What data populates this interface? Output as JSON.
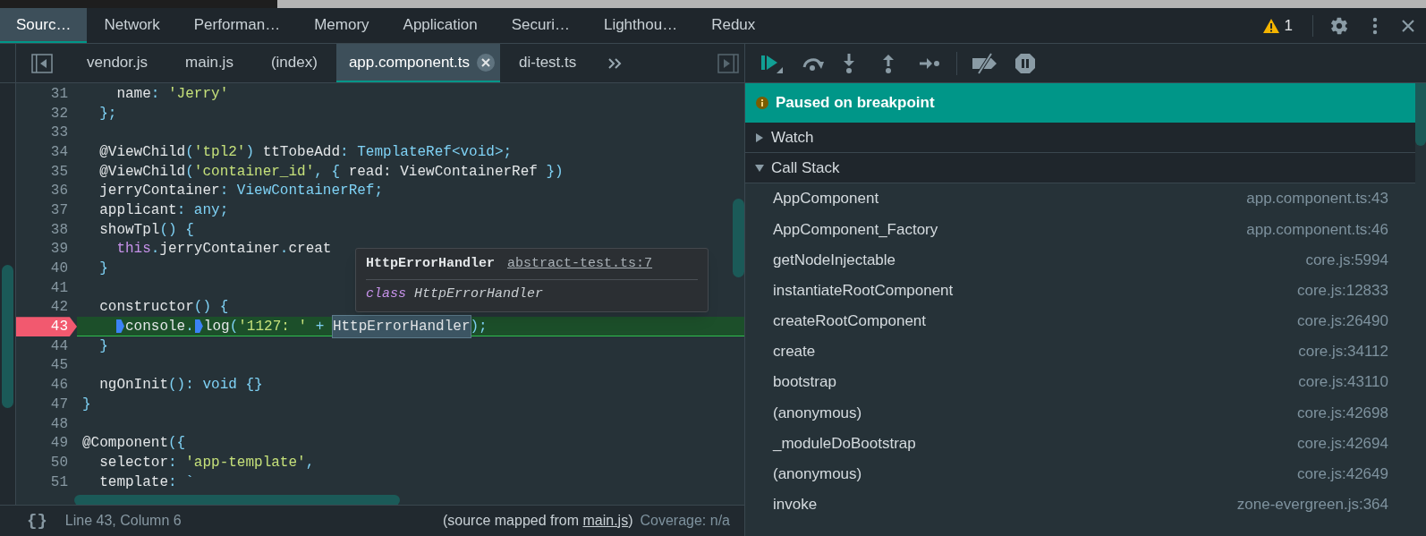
{
  "main_tabs": [
    {
      "label": "Sourc…",
      "selected": true
    },
    {
      "label": "Network",
      "selected": false
    },
    {
      "label": "Performan…",
      "selected": false
    },
    {
      "label": "Memory",
      "selected": false
    },
    {
      "label": "Application",
      "selected": false
    },
    {
      "label": "Securi…",
      "selected": false
    },
    {
      "label": "Lighthou…",
      "selected": false
    },
    {
      "label": "Redux",
      "selected": false
    }
  ],
  "warning_count": "1",
  "file_tabs": [
    {
      "label": "vendor.js",
      "selected": false
    },
    {
      "label": "main.js",
      "selected": false
    },
    {
      "label": "(index)",
      "selected": false
    },
    {
      "label": "app.component.ts",
      "selected": true
    },
    {
      "label": "di-test.ts",
      "selected": false
    }
  ],
  "code_lines": [
    {
      "number": "31",
      "paused": false,
      "tokens": [
        {
          "text": "    name",
          "kind": "plain"
        },
        {
          "text": ": ",
          "kind": "punct"
        },
        {
          "text": "'Jerry'",
          "kind": "string"
        }
      ]
    },
    {
      "number": "32",
      "paused": false,
      "tokens": [
        {
          "text": "  };",
          "kind": "punct"
        }
      ]
    },
    {
      "number": "33",
      "paused": false
    },
    {
      "number": "34",
      "paused": false,
      "tokens": [
        {
          "text": "  @ViewChild",
          "kind": "plain"
        },
        {
          "text": "(",
          "kind": "punct"
        },
        {
          "text": "'tpl2'",
          "kind": "string"
        },
        {
          "text": ")",
          "kind": "punct"
        },
        {
          "text": " ttTobeAdd",
          "kind": "plain"
        },
        {
          "text": ": TemplateRef<void>;",
          "kind": "punct"
        }
      ]
    },
    {
      "number": "35",
      "paused": false,
      "tokens": [
        {
          "text": "  @ViewChild",
          "kind": "plain"
        },
        {
          "text": "(",
          "kind": "punct"
        },
        {
          "text": "'container_id'",
          "kind": "string"
        },
        {
          "text": ", { ",
          "kind": "punct"
        },
        {
          "text": "read: ViewContainerRef",
          "kind": "plain"
        },
        {
          "text": " })",
          "kind": "punct"
        }
      ]
    },
    {
      "number": "36",
      "paused": false,
      "tokens": [
        {
          "text": "  jerryContainer",
          "kind": "plain"
        },
        {
          "text": ": ViewContainerRef;",
          "kind": "punct"
        }
      ]
    },
    {
      "number": "37",
      "paused": false,
      "tokens": [
        {
          "text": "  applicant",
          "kind": "plain"
        },
        {
          "text": ": any;",
          "kind": "punct"
        }
      ]
    },
    {
      "number": "38",
      "paused": false,
      "tokens": [
        {
          "text": "  showTpl",
          "kind": "plain"
        },
        {
          "text": "() {",
          "kind": "punct"
        }
      ]
    },
    {
      "number": "39",
      "paused": false,
      "tokens": [
        {
          "text": "    this",
          "kind": "keyword"
        },
        {
          "text": ".",
          "kind": "punct"
        },
        {
          "text": "jerryContainer",
          "kind": "plain"
        },
        {
          "text": ".",
          "kind": "punct"
        },
        {
          "text": "creat",
          "kind": "plain"
        }
      ]
    },
    {
      "number": "40",
      "paused": false,
      "tokens": [
        {
          "text": "  }",
          "kind": "punct"
        }
      ]
    },
    {
      "number": "41",
      "paused": false
    },
    {
      "number": "42",
      "paused": false,
      "tokens": [
        {
          "text": "  constructor",
          "kind": "plain"
        },
        {
          "text": "() {",
          "kind": "punct"
        }
      ]
    },
    {
      "number": "43",
      "paused": true,
      "tokens": [
        {
          "kind": "breakpoint"
        },
        {
          "text": "console",
          "kind": "plain"
        },
        {
          "text": ".",
          "kind": "punct"
        },
        {
          "kind": "breakpoint"
        },
        {
          "text": "log",
          "kind": "plain"
        },
        {
          "text": "(",
          "kind": "punct"
        },
        {
          "text": "'1127: '",
          "kind": "string"
        },
        {
          "text": " + ",
          "kind": "punct"
        },
        {
          "text": "HttpErrorHandler",
          "kind": "hover"
        },
        {
          "text": ");",
          "kind": "punct"
        }
      ]
    },
    {
      "number": "44",
      "paused": false,
      "tokens": [
        {
          "text": "  }",
          "kind": "punct"
        }
      ]
    },
    {
      "number": "45",
      "paused": false
    },
    {
      "number": "46",
      "paused": false,
      "tokens": [
        {
          "text": "  ngOnInit",
          "kind": "plain"
        },
        {
          "text": "(): void {}",
          "kind": "punct"
        }
      ]
    },
    {
      "number": "47",
      "paused": false,
      "tokens": [
        {
          "text": "}",
          "kind": "punct"
        }
      ]
    },
    {
      "number": "48",
      "paused": false
    },
    {
      "number": "49",
      "paused": false,
      "tokens": [
        {
          "text": "@Component",
          "kind": "plain"
        },
        {
          "text": "({",
          "kind": "punct"
        }
      ]
    },
    {
      "number": "50",
      "paused": false,
      "tokens": [
        {
          "text": "  selector",
          "kind": "plain"
        },
        {
          "text": ": ",
          "kind": "punct"
        },
        {
          "text": "'app-template'",
          "kind": "string"
        },
        {
          "text": ",",
          "kind": "punct"
        }
      ]
    },
    {
      "number": "51",
      "paused": false,
      "tokens": [
        {
          "text": "  template",
          "kind": "plain"
        },
        {
          "text": ": `",
          "kind": "punct"
        }
      ]
    }
  ],
  "tooltip": {
    "name": "HttpErrorHandler",
    "link": "abstract-test.ts:7",
    "keyword": "class",
    "signature": "HttpErrorHandler"
  },
  "status_bar": {
    "format_button": "{}",
    "position": "Line 43, Column 6",
    "source_prefix": "(source mapped from ",
    "source_link": "main.js",
    "source_suffix": ")",
    "coverage": "Coverage: n/a"
  },
  "banner": "Paused on breakpoint",
  "sections": [
    {
      "label": "Watch",
      "expanded": false
    },
    {
      "label": "Call Stack",
      "expanded": true
    }
  ],
  "call_stack": [
    {
      "function": "AppComponent",
      "location": "app.component.ts:43"
    },
    {
      "function": "AppComponent_Factory",
      "location": "app.component.ts:46"
    },
    {
      "function": "getNodeInjectable",
      "location": "core.js:5994"
    },
    {
      "function": "instantiateRootComponent",
      "location": "core.js:12833"
    },
    {
      "function": "createRootComponent",
      "location": "core.js:26490"
    },
    {
      "function": "create",
      "location": "core.js:34112"
    },
    {
      "function": "bootstrap",
      "location": "core.js:43110"
    },
    {
      "function": "(anonymous)",
      "location": "core.js:42698"
    },
    {
      "function": "_moduleDoBootstrap",
      "location": "core.js:42694"
    },
    {
      "function": "(anonymous)",
      "location": "core.js:42649"
    },
    {
      "function": "invoke",
      "location": "zone-evergreen.js:364"
    }
  ]
}
